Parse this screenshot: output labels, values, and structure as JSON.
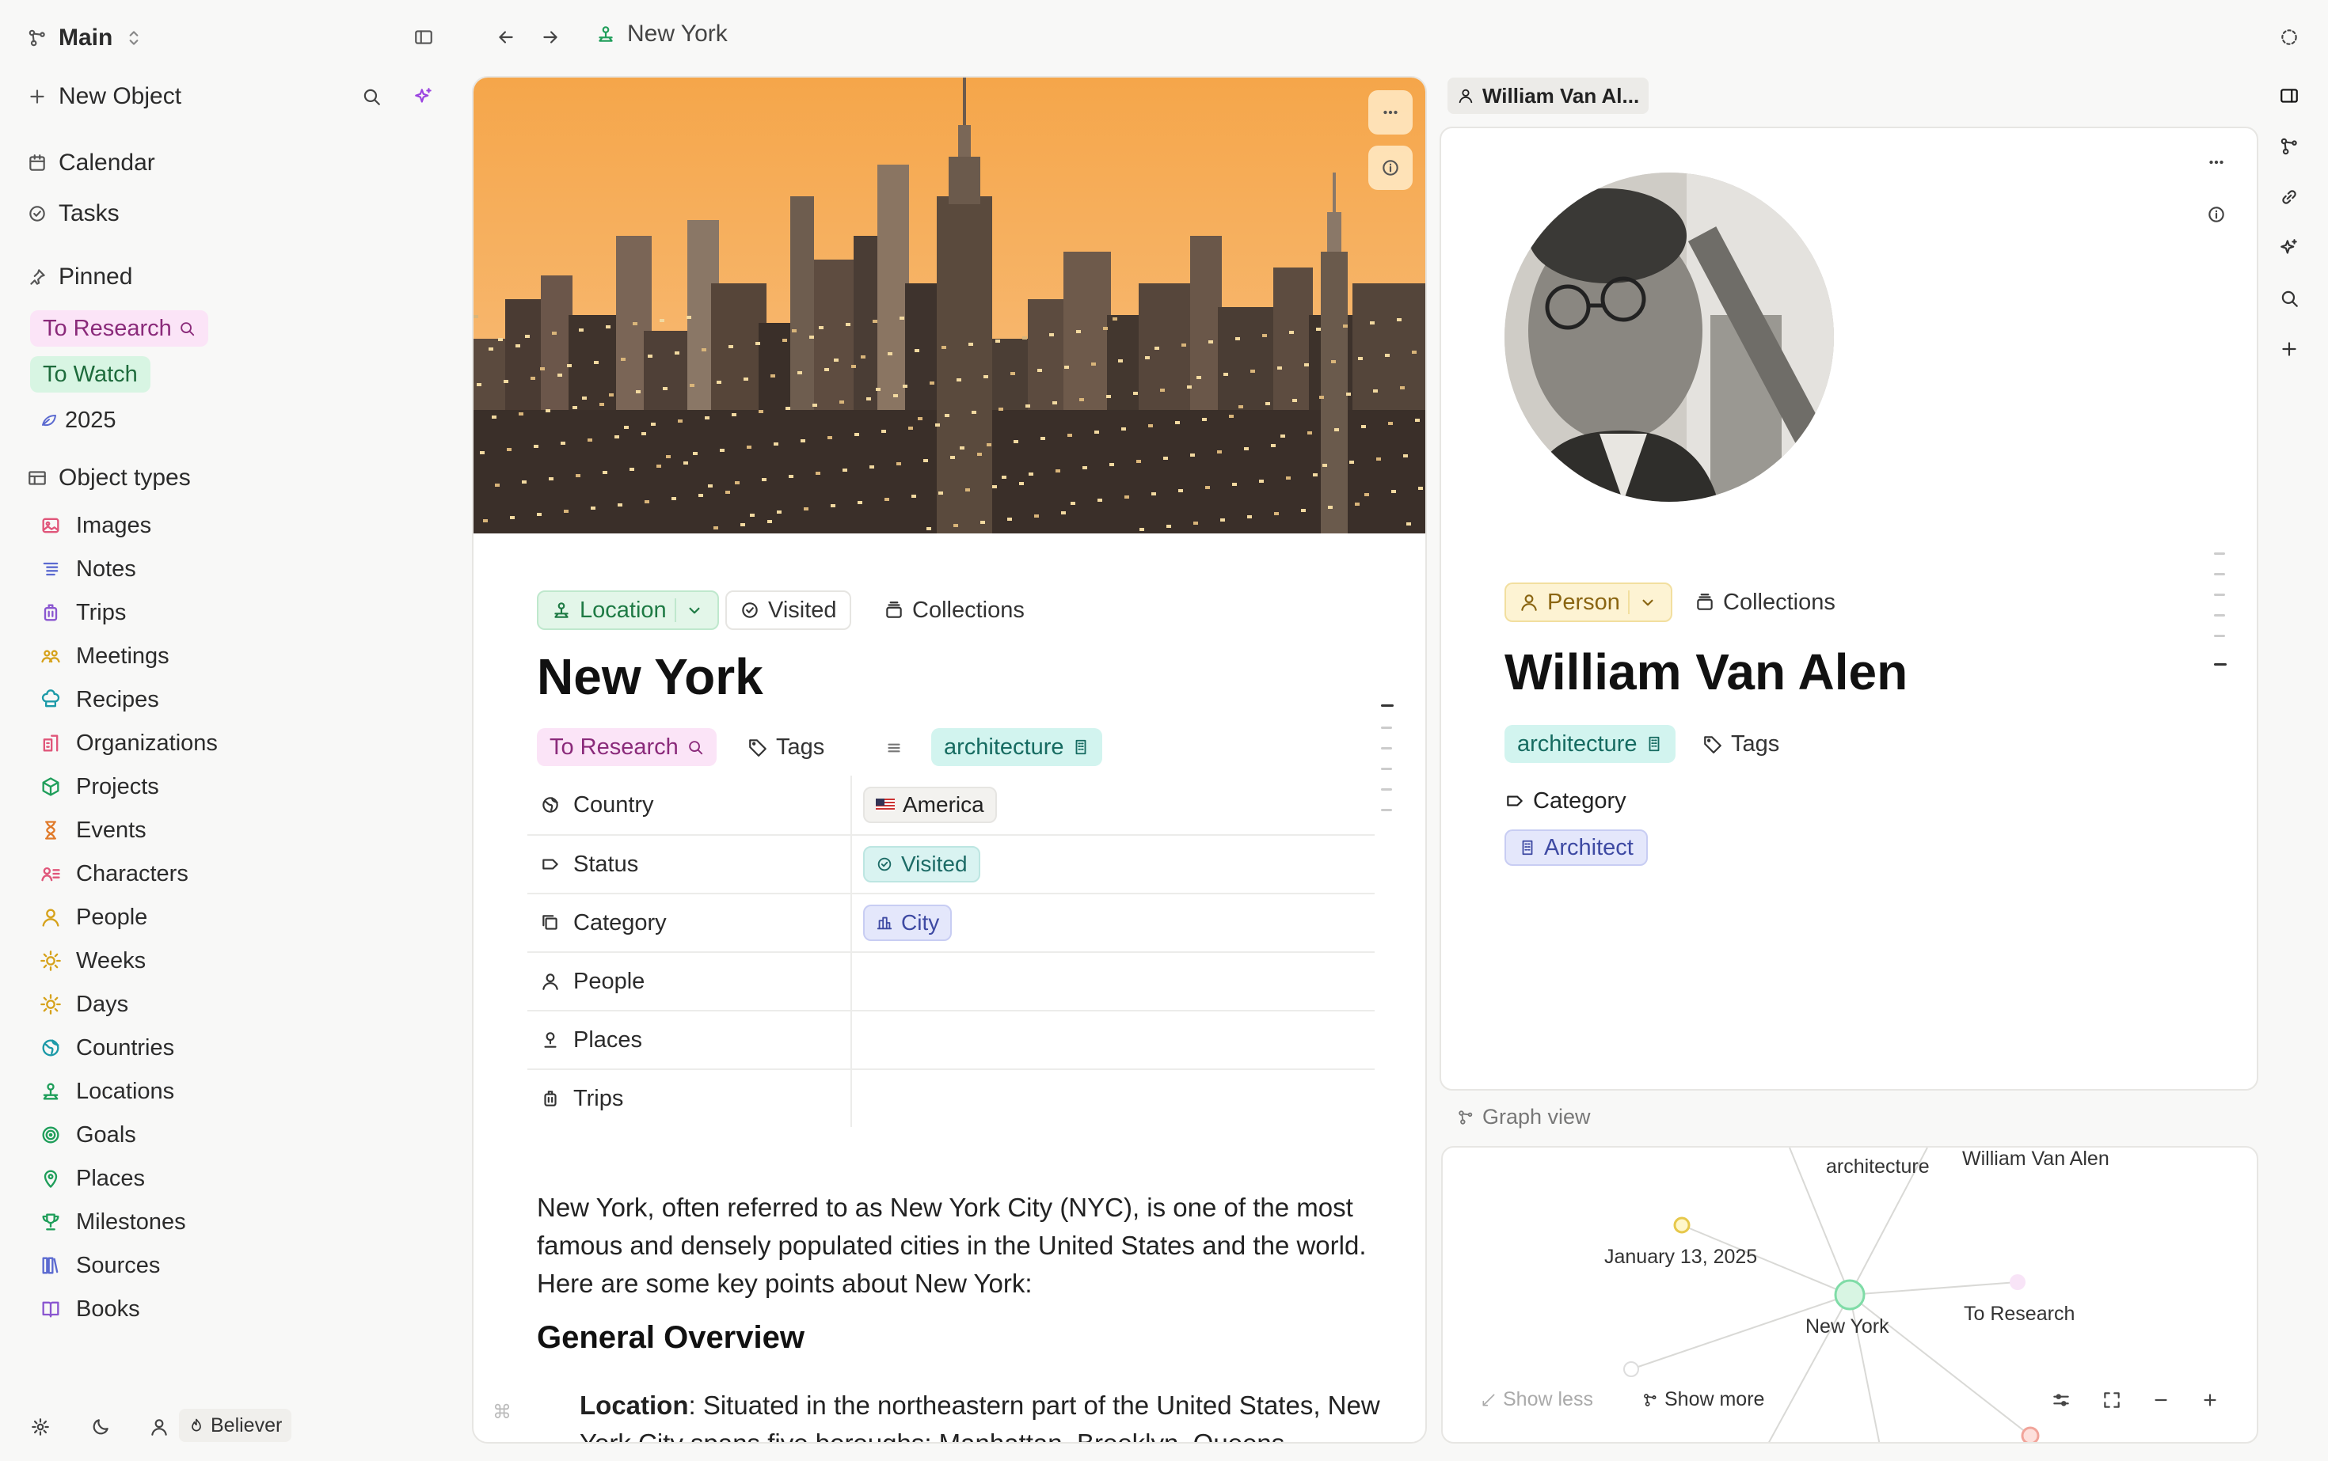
{
  "sidebar": {
    "space_name": "Main",
    "new_object": "New Object",
    "calendar": "Calendar",
    "tasks": "Tasks",
    "pinned_label": "Pinned",
    "pinned": [
      {
        "label": "To Research",
        "color": "#fbe4f7",
        "text_color": "#8a2a7a"
      },
      {
        "label": "To Watch",
        "color": "#d8f5e3",
        "text_color": "#1e6b3c"
      },
      {
        "label": "2025",
        "color": "transparent",
        "text_color": "#2b2b2b"
      }
    ],
    "object_types_label": "Object types",
    "object_types": [
      {
        "label": "Images",
        "icon": "image-icon",
        "color": "#e0567a"
      },
      {
        "label": "Notes",
        "icon": "notes-icon",
        "color": "#5b6ad0"
      },
      {
        "label": "Trips",
        "icon": "luggage-icon",
        "color": "#8a56d0"
      },
      {
        "label": "Meetings",
        "icon": "people-group-icon",
        "color": "#d6a21b"
      },
      {
        "label": "Recipes",
        "icon": "chef-icon",
        "color": "#1c9aa8"
      },
      {
        "label": "Organizations",
        "icon": "building-icon",
        "color": "#e0567a"
      },
      {
        "label": "Projects",
        "icon": "cube-icon",
        "color": "#1f9e5a"
      },
      {
        "label": "Events",
        "icon": "hourglass-icon",
        "color": "#e07a2a"
      },
      {
        "label": "Characters",
        "icon": "character-icon",
        "color": "#e0567a"
      },
      {
        "label": "People",
        "icon": "person-icon",
        "color": "#d6a21b"
      },
      {
        "label": "Weeks",
        "icon": "sun-icon",
        "color": "#d6a21b"
      },
      {
        "label": "Days",
        "icon": "sun-icon",
        "color": "#d6a21b"
      },
      {
        "label": "Countries",
        "icon": "globe-icon",
        "color": "#1c9aa8"
      },
      {
        "label": "Locations",
        "icon": "location-icon",
        "color": "#1f9e5a"
      },
      {
        "label": "Goals",
        "icon": "target-icon",
        "color": "#1f9e5a"
      },
      {
        "label": "Places",
        "icon": "pin-icon",
        "color": "#1f9e5a"
      },
      {
        "label": "Milestones",
        "icon": "trophy-icon",
        "color": "#1f9e5a"
      },
      {
        "label": "Sources",
        "icon": "library-icon",
        "color": "#5b6ad0"
      },
      {
        "label": "Books",
        "icon": "book-icon",
        "color": "#8a56d0"
      }
    ],
    "user_badge": "Believer"
  },
  "topbar": {
    "breadcrumb": "New York"
  },
  "main": {
    "type_chip": "Location",
    "visited_chip": "Visited",
    "collections_chip": "Collections",
    "title": "New York",
    "to_research_tag": "To Research",
    "tags_label": "Tags",
    "architecture_tag": "architecture",
    "properties": [
      {
        "name": "Country",
        "value": "America",
        "icon": "globe-icon"
      },
      {
        "name": "Status",
        "value": "Visited",
        "icon": "status-icon"
      },
      {
        "name": "Category",
        "value": "City",
        "icon": "category-icon"
      },
      {
        "name": "People",
        "value": "",
        "icon": "person-icon"
      },
      {
        "name": "Places",
        "value": "",
        "icon": "places-icon"
      },
      {
        "name": "Trips",
        "value": "",
        "icon": "luggage-icon"
      }
    ],
    "body_paragraph": "New York, often referred to as New York City (NYC), is one of the most famous and densely populated cities in the United States and the world. Here are some key points about New York:",
    "heading": "General Overview",
    "bullet_label": "Location",
    "bullet_text": ": Situated in the northeastern part of the United States, New York City spans five boroughs: Manhattan, Brooklyn, Queens,"
  },
  "side": {
    "tab_label": "William Van Al...",
    "type_chip": "Person",
    "collections_chip": "Collections",
    "title": "William Van Alen",
    "architecture_tag": "architecture",
    "tags_label": "Tags",
    "category_label": "Category",
    "category_value": "Architect"
  },
  "graph": {
    "label": "Graph view",
    "nodes": {
      "architecture": "architecture",
      "william": "William Van Alen",
      "jan": "January 13, 2025",
      "newyork": "New York",
      "research": "To Research"
    },
    "show_less": "Show less",
    "show_more": "Show more"
  }
}
